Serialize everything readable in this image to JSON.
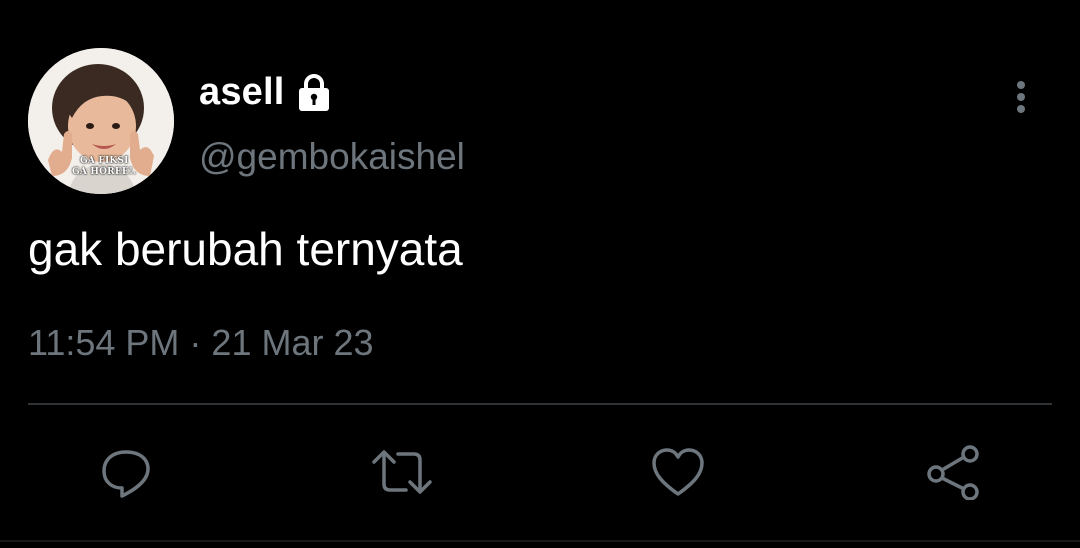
{
  "tweet": {
    "display_name": "asell",
    "protected_icon": "lock-icon",
    "handle": "@gembokaishel",
    "text": "gak berubah ternyata",
    "time": "11:54 PM",
    "separator": "·",
    "date": "21 Mar 23",
    "avatar": {
      "caption_line1": "GA FIKSI",
      "caption_line2": "GA HOREE!."
    }
  },
  "actions": [
    {
      "name": "reply",
      "icon": "comment-icon"
    },
    {
      "name": "retweet",
      "icon": "retweet-icon"
    },
    {
      "name": "like",
      "icon": "heart-icon"
    },
    {
      "name": "share",
      "icon": "share-icon"
    }
  ],
  "colors": {
    "background": "#000000",
    "primary_text": "#ffffff",
    "secondary_text": "#6e767d",
    "divider": "#2f3336",
    "icon": "#6e767d"
  }
}
